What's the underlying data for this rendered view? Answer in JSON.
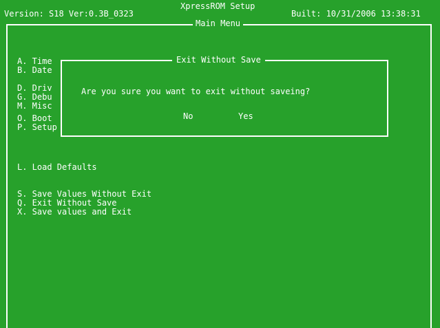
{
  "header": {
    "app_title": "XpressROM Setup",
    "version": "Version: S18 Ver:0.3B_0323",
    "built": "Built: 10/31/2006 13:38:31"
  },
  "main_menu": {
    "title": "Main Menu",
    "items": [
      {
        "label": "A. Time"
      },
      {
        "label": "B. Date"
      },
      {
        "label": "D. Driv"
      },
      {
        "label": "G. Debu"
      },
      {
        "label": "M. Misc"
      },
      {
        "label": "O. Boot"
      },
      {
        "label": "P. Setup SCU Password"
      },
      {
        "label": "L. Load Defaults"
      },
      {
        "label": "S. Save Values Without Exit"
      },
      {
        "label": "Q. Exit Without Save"
      },
      {
        "label": "X. Save values and Exit"
      }
    ]
  },
  "dialog": {
    "title": "Exit Without Save",
    "message": "Are you sure you want to exit without saveing?",
    "no_label": "No",
    "yes_label": "Yes"
  },
  "colors": {
    "background": "#27a12b",
    "foreground": "#ffffff"
  }
}
